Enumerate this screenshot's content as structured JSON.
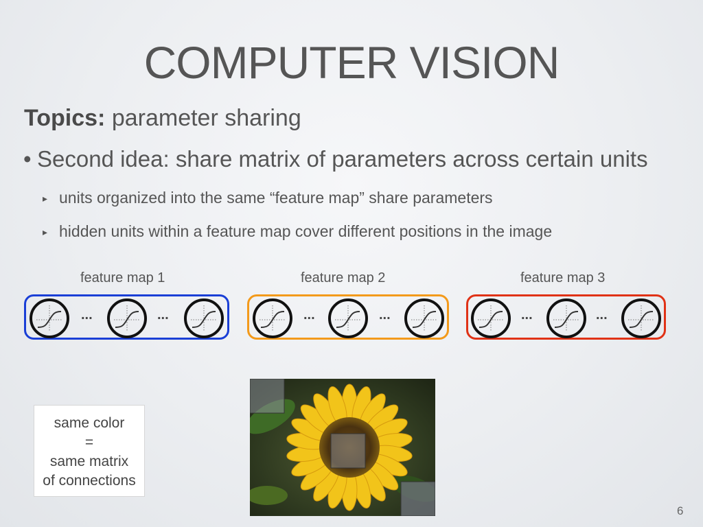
{
  "slide": {
    "title": "COMPUTER VISION",
    "topics_label": "Topics:",
    "topics_value": "parameter sharing",
    "bullet_marker": "•",
    "bullet_main": "Second idea: share matrix of parameters across certain units",
    "sub_marker": "▸",
    "sub_bullets": [
      "units organized into the same “feature map” share parameters",
      "hidden units within a feature map cover different positions in the image"
    ],
    "page_number": "6"
  },
  "feature_maps": [
    {
      "label": "feature map 1",
      "color": "#1a3fd6"
    },
    {
      "label": "feature map 2",
      "color": "#f39a1b"
    },
    {
      "label": "feature map 3",
      "color": "#e03216"
    }
  ],
  "ellipsis": "...",
  "legend": {
    "lines": [
      "same color",
      "=",
      "same matrix",
      "of connections"
    ]
  },
  "image": {
    "subject": "sunflower",
    "highlight_color": "#7a8088"
  }
}
